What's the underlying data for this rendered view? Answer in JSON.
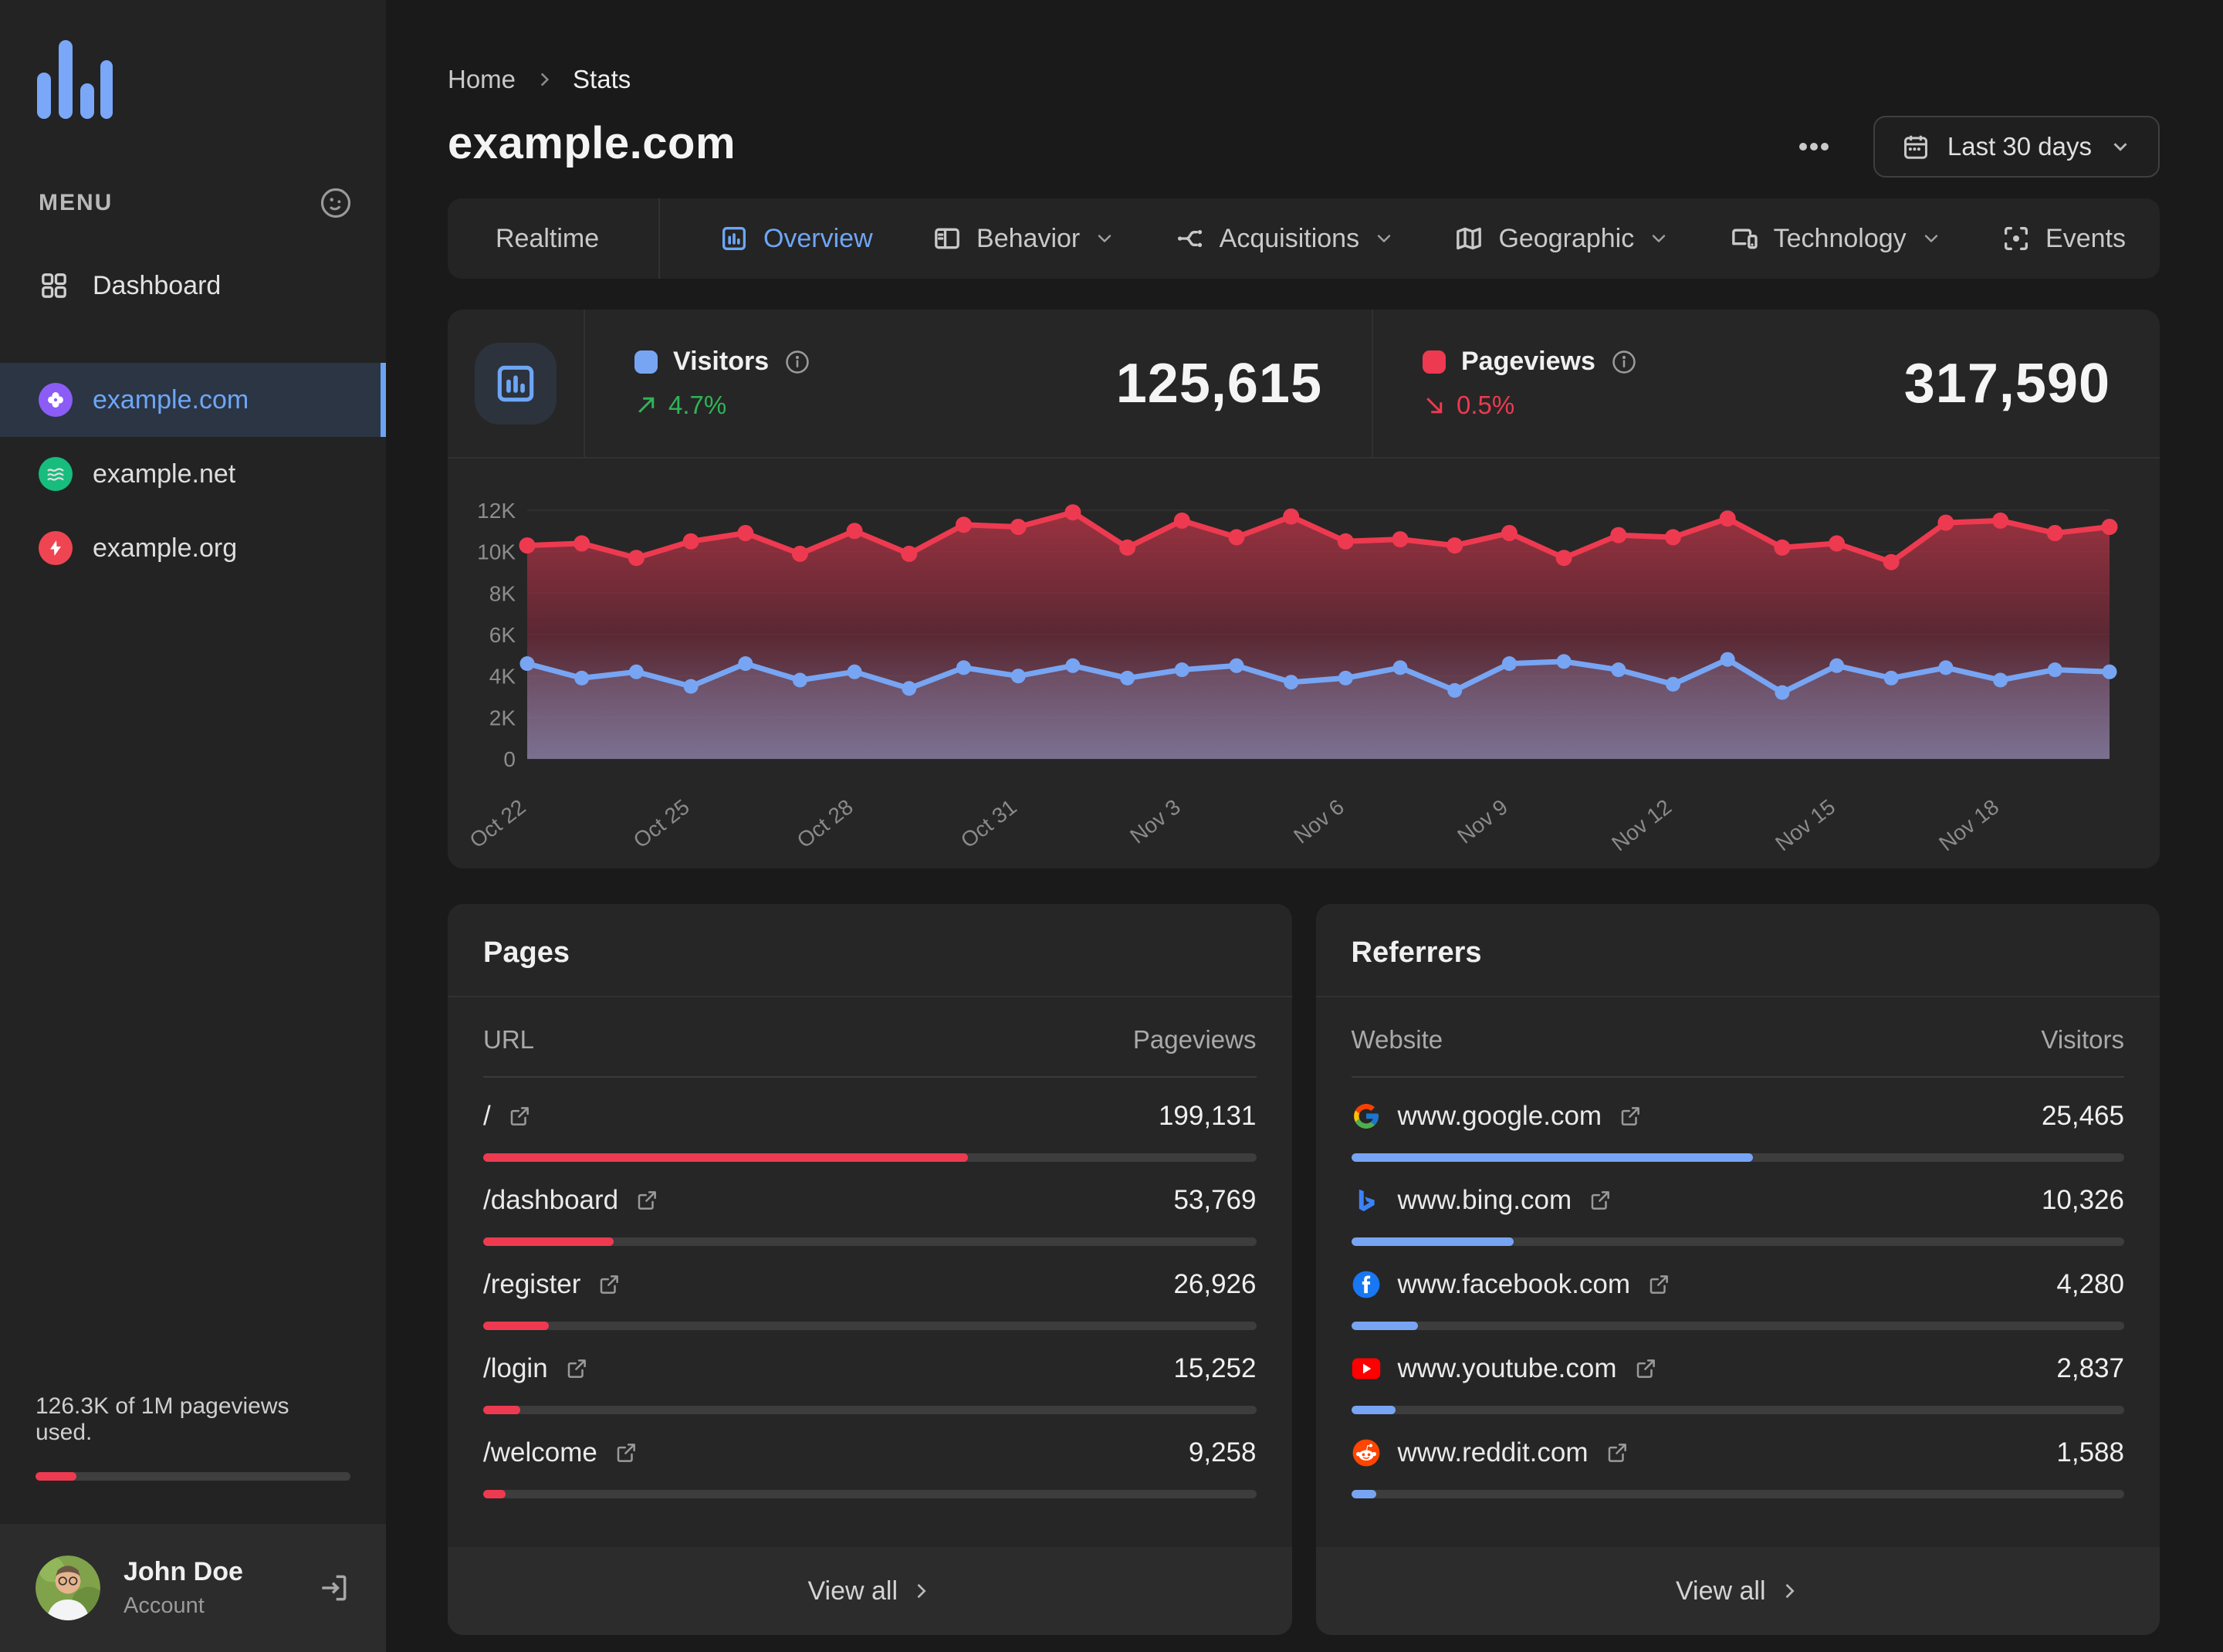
{
  "colors": {
    "accent_blue": "#77a5f3",
    "accent_red": "#ee3a50",
    "green": "#30c653",
    "site_purple": "#8b5cf6",
    "site_green": "#16bd7d",
    "site_red": "#ef4552"
  },
  "sidebar": {
    "menu_label": "MENU",
    "dashboard_label": "Dashboard",
    "sites": [
      {
        "name": "example.com",
        "icon": "clover",
        "color": "#8b5cf6",
        "active": true
      },
      {
        "name": "example.net",
        "icon": "waves",
        "color": "#16bd7d",
        "active": false
      },
      {
        "name": "example.org",
        "icon": "bolt",
        "color": "#ef4552",
        "active": false
      }
    ],
    "usage_text": "126.3K of 1M pageviews used.",
    "usage_percent": 13,
    "user": {
      "name": "John Doe",
      "role": "Account"
    }
  },
  "header": {
    "breadcrumb_home": "Home",
    "breadcrumb_current": "Stats",
    "title": "example.com",
    "date_range_label": "Last 30 days"
  },
  "tabs": [
    {
      "label": "Realtime",
      "icon": "realtime",
      "active": false,
      "chevron": false
    },
    {
      "label": "Overview",
      "icon": "overview",
      "active": true,
      "chevron": false
    },
    {
      "label": "Behavior",
      "icon": "behavior",
      "active": false,
      "chevron": true
    },
    {
      "label": "Acquisitions",
      "icon": "acquisitions",
      "active": false,
      "chevron": true
    },
    {
      "label": "Geographic",
      "icon": "geographic",
      "active": false,
      "chevron": true
    },
    {
      "label": "Technology",
      "icon": "technology",
      "active": false,
      "chevron": true
    },
    {
      "label": "Events",
      "icon": "events",
      "active": false,
      "chevron": false
    }
  ],
  "overview": {
    "visitors": {
      "label": "Visitors",
      "value": "125,615",
      "delta": "4.7%",
      "direction": "up"
    },
    "pageviews": {
      "label": "Pageviews",
      "value": "317,590",
      "delta": "0.5%",
      "direction": "down"
    }
  },
  "chart_data": {
    "type": "area",
    "title": "Visitors vs Pageviews, last 30 days",
    "categories": [
      "Oct 22",
      "Oct 23",
      "Oct 24",
      "Oct 25",
      "Oct 26",
      "Oct 27",
      "Oct 28",
      "Oct 29",
      "Oct 30",
      "Oct 31",
      "Nov 1",
      "Nov 2",
      "Nov 3",
      "Nov 4",
      "Nov 5",
      "Nov 6",
      "Nov 7",
      "Nov 8",
      "Nov 9",
      "Nov 10",
      "Nov 11",
      "Nov 12",
      "Nov 13",
      "Nov 14",
      "Nov 15",
      "Nov 16",
      "Nov 17",
      "Nov 18",
      "Nov 19",
      "Nov 20"
    ],
    "x_tick_labels": [
      "Oct 22",
      "Oct 25",
      "Oct 28",
      "Oct 31",
      "Nov 3",
      "Nov 6",
      "Nov 9",
      "Nov 12",
      "Nov 15",
      "Nov 18"
    ],
    "x_tick_every": 3,
    "y_ticks": [
      0,
      2000,
      4000,
      6000,
      8000,
      10000,
      12000
    ],
    "y_tick_labels": [
      "0",
      "2K",
      "4K",
      "6K",
      "8K",
      "10K",
      "12K"
    ],
    "ylim": [
      0,
      12000
    ],
    "grid": true,
    "series": [
      {
        "name": "Pageviews",
        "color": "#ee3a50",
        "values": [
          10300,
          10400,
          9700,
          10500,
          10900,
          9900,
          11000,
          9900,
          11300,
          11200,
          11900,
          10200,
          11500,
          10700,
          11700,
          10500,
          10600,
          10300,
          10900,
          9700,
          10800,
          10700,
          11600,
          10200,
          10400,
          9500,
          11400,
          11500,
          10900,
          11200
        ]
      },
      {
        "name": "Visitors",
        "color": "#77a5f3",
        "values": [
          4600,
          3900,
          4200,
          3500,
          4600,
          3800,
          4200,
          3400,
          4400,
          4000,
          4500,
          3900,
          4300,
          4500,
          3700,
          3900,
          4400,
          3300,
          4600,
          4700,
          4300,
          3600,
          4800,
          3200,
          4500,
          3900,
          4400,
          3800,
          4300,
          4200
        ]
      }
    ]
  },
  "pages_card": {
    "title": "Pages",
    "col_left": "URL",
    "col_right": "Pageviews",
    "bar_color": "#ee3a50",
    "rows": [
      {
        "label": "/",
        "value": "199,131",
        "percent": 62.7
      },
      {
        "label": "/dashboard",
        "value": "53,769",
        "percent": 16.9
      },
      {
        "label": "/register",
        "value": "26,926",
        "percent": 8.5
      },
      {
        "label": "/login",
        "value": "15,252",
        "percent": 4.8
      },
      {
        "label": "/welcome",
        "value": "9,258",
        "percent": 2.9
      }
    ],
    "view_all_label": "View all"
  },
  "referrers_card": {
    "title": "Referrers",
    "col_left": "Website",
    "col_right": "Visitors",
    "bar_color": "#77a5f3",
    "rows": [
      {
        "label": "www.google.com",
        "favicon": "google",
        "value": "25,465",
        "percent": 52
      },
      {
        "label": "www.bing.com",
        "favicon": "bing",
        "value": "10,326",
        "percent": 21
      },
      {
        "label": "www.facebook.com",
        "favicon": "facebook",
        "value": "4,280",
        "percent": 8.6
      },
      {
        "label": "www.youtube.com",
        "favicon": "youtube",
        "value": "2,837",
        "percent": 5.7
      },
      {
        "label": "www.reddit.com",
        "favicon": "reddit",
        "value": "1,588",
        "percent": 3.2
      }
    ],
    "view_all_label": "View all"
  }
}
